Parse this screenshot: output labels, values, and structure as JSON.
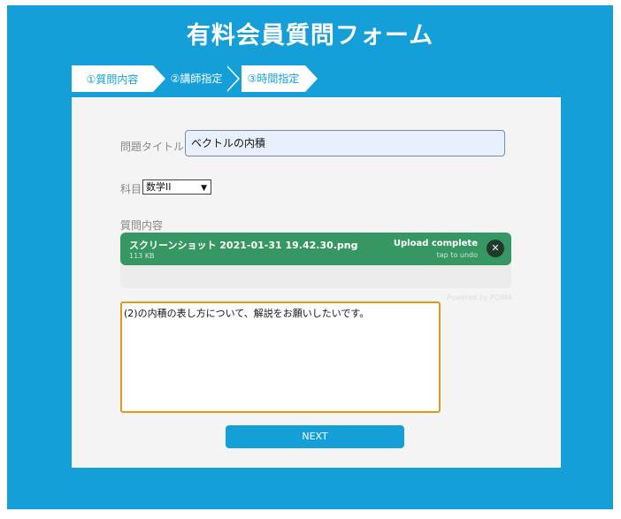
{
  "header": {
    "title": "有料会員質問フォーム"
  },
  "steps": [
    {
      "label": "①質問内容"
    },
    {
      "label": "②講師指定"
    },
    {
      "label": "③時間指定"
    }
  ],
  "form": {
    "title_label": "問題タイトル",
    "title_value": "ベクトルの内積",
    "subject_label": "科目",
    "subject_value": "数学II",
    "content_label": "質問内容",
    "upload": {
      "file_name": "スクリーンショット 2021-01-31 19.42.30.png",
      "file_size": "113 KB",
      "status": "Upload complete",
      "undo": "tap to undo",
      "close_symbol": "✕",
      "powered_by": "Powered by PQINA"
    },
    "question_text": "(2)の内積の表し方について、解説をお願いしたいです。",
    "next_label": "NEXT"
  },
  "colors": {
    "brand": "#159fd8",
    "upload_success": "#369763",
    "textarea_border": "#d89b1d"
  }
}
